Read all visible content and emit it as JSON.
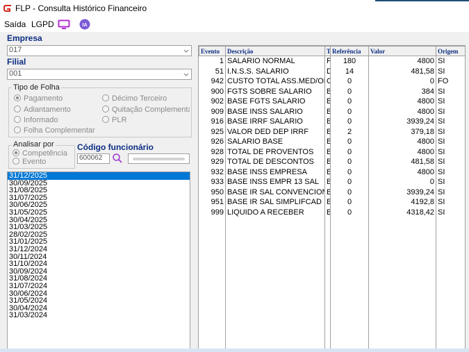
{
  "window": {
    "title": "FLP - Consulta Histórico Financeiro"
  },
  "menu": {
    "items": [
      "Saída",
      "LGPD"
    ],
    "ia_label": "IA"
  },
  "empresa": {
    "label": "Empresa",
    "value": "017"
  },
  "filial": {
    "label": "Filial",
    "value": "001"
  },
  "tipo_folha": {
    "title": "Tipo de Folha",
    "options": [
      "Pagamento",
      "Adiantamento",
      "Informado",
      "Folha Complementar",
      "Décimo Terceiro",
      "Quitação Complementar",
      "PLR"
    ],
    "selected": "Pagamento"
  },
  "analisar_por": {
    "title": "Analisar por",
    "options": [
      "Competência",
      "Evento"
    ],
    "selected": "Competência"
  },
  "funcionario": {
    "label": "Código funcionário",
    "code": "600062",
    "name": ""
  },
  "dates": [
    "31/12/2025",
    "30/09/2025",
    "31/08/2025",
    "31/07/2025",
    "30/06/2025",
    "31/05/2025",
    "30/04/2025",
    "31/03/2025",
    "28/02/2025",
    "31/01/2025",
    "31/12/2024",
    "30/11/2024",
    "31/10/2024",
    "30/09/2024",
    "31/08/2024",
    "31/07/2024",
    "30/06/2024",
    "31/05/2024",
    "30/04/2024",
    "31/03/2024"
  ],
  "selected_date": "31/12/2025",
  "grid": {
    "headers": [
      "Evento",
      "Descrição",
      "T",
      "Referência",
      "Valor",
      "Origem"
    ],
    "rows": [
      [
        "1",
        "SALARIO NORMAL",
        "P",
        "180",
        "4800",
        "SI"
      ],
      [
        "51",
        "I.N.S.S. SALARIO",
        "D",
        "14",
        "481,58",
        "SI"
      ],
      [
        "942",
        "CUSTO TOTAL ASS.MED/OD",
        "C",
        "0",
        "0",
        "FO"
      ],
      [
        "900",
        "FGTS SOBRE SALARIO",
        "B",
        "0",
        "384",
        "SI"
      ],
      [
        "902",
        "BASE FGTS SALARIO",
        "B",
        "0",
        "4800",
        "SI"
      ],
      [
        "909",
        "BASE INSS SALARIO",
        "B",
        "0",
        "4800",
        "SI"
      ],
      [
        "916",
        "BASE IRRF SALARIO",
        "B",
        "0",
        "3939,24",
        "SI"
      ],
      [
        "925",
        "VALOR DED DEP IRRF",
        "B",
        "2",
        "379,18",
        "SI"
      ],
      [
        "926",
        "SALARIO BASE",
        "B",
        "0",
        "4800",
        "SI"
      ],
      [
        "928",
        "TOTAL DE PROVENTOS",
        "B",
        "0",
        "4800",
        "SI"
      ],
      [
        "929",
        "TOTAL DE DESCONTOS",
        "B",
        "0",
        "481,58",
        "SI"
      ],
      [
        "932",
        "BASE INSS EMPRESA",
        "B",
        "0",
        "4800",
        "SI"
      ],
      [
        "933",
        "BASE INSS EMPR 13 SAL",
        "B",
        "0",
        "0",
        "SI"
      ],
      [
        "950",
        "BASE IR SAL CONVENCION",
        "B",
        "0",
        "3939,24",
        "SI"
      ],
      [
        "951",
        "BASE IR SAL SIMPLIFCAD",
        "B",
        "0",
        "4192,8",
        "SI"
      ],
      [
        "999",
        "LIQUIDO A RECEBER",
        "B",
        "0",
        "4318,42",
        "SI"
      ]
    ]
  },
  "colors": {
    "label_blue": "#0c2d83",
    "selection": "#0078d7",
    "logo_red": "#d9261c",
    "ia_purple": "#7b5bd6"
  }
}
